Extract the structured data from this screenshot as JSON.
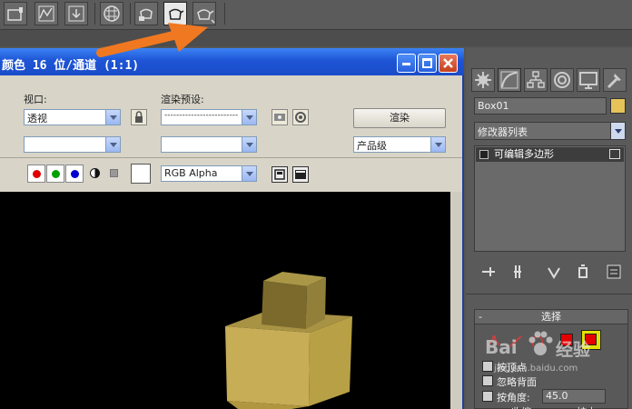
{
  "render_window": {
    "title": "颜色 16 位/通道 (1:1)",
    "viewport_label": "视口:",
    "viewport_value": "透视",
    "preset_label": "渲染预设:",
    "preset_value": "-------------------------",
    "render_button": "渲染",
    "quality_value": "产品级",
    "channel_value": "RGB Alpha"
  },
  "command_panel": {
    "object_name": "Box01",
    "object_color": "#e6c45a",
    "modifier_list": "修改器列表",
    "stack_item": "可编辑多边形",
    "selection_rollout": {
      "title": "选择",
      "collapse": "-",
      "by_vertex": "按顶点",
      "ignore_backfacing": "忽略背面",
      "by_angle": "按角度:",
      "angle_value": "45.0",
      "shrink": "收缩",
      "grow": "扩大"
    }
  },
  "watermark": {
    "brand": "Bai",
    "brand_suffix": "经验",
    "url": "jingyan.baidu.com"
  },
  "colors": {
    "titlebar": "#1e55d6",
    "highlight_arrow": "#f07820",
    "active_subobject": "#e3e000",
    "box_color": "#c8a84a"
  }
}
